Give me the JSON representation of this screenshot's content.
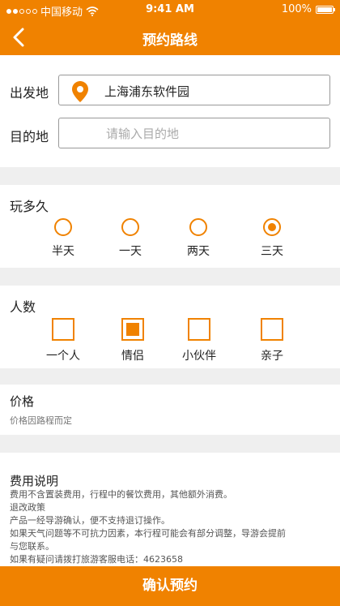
{
  "status_bar": {
    "carrier": "中国移动",
    "time": "9:41 AM",
    "battery": "100%"
  },
  "nav": {
    "title": "预约路线",
    "back_icon": "chevron-left-icon"
  },
  "route": {
    "origin_label": "出发地",
    "origin_value": "上海浦东软件园",
    "destination_label": "目的地",
    "destination_value": "",
    "destination_placeholder": "请输入目的地"
  },
  "duration": {
    "title": "玩多久",
    "options": [
      "半天",
      "一天",
      "两天",
      "三天"
    ],
    "selected": "三天"
  },
  "people": {
    "title": "人数",
    "options": [
      "一个人",
      "情侣",
      "小伙伴",
      "亲子"
    ],
    "selected": "情侣"
  },
  "price": {
    "title": "价格",
    "note": "价格因路程而定"
  },
  "fee": {
    "title": "费用说明",
    "lines": [
      "费用不含置装费用，行程中的餐饮费用，其他额外消费。",
      "退改政策",
      "产品一经导游确认，便不支持退订操作。",
      "如果天气问题等不可抗力因素，本行程可能会有部分调整，导游会提前",
      "与您联系。",
      "如果有疑问请拨打旅游客服电话：4623658"
    ]
  },
  "confirm_button": "确认预约",
  "colors": {
    "accent": "#f08200",
    "background": "#efefef"
  }
}
